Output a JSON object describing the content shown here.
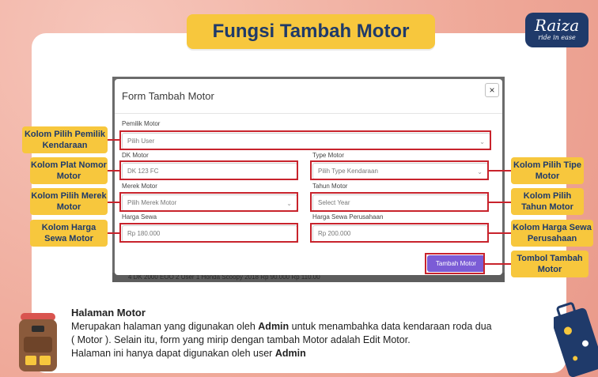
{
  "slide": {
    "title": "Fungsi Tambah Motor",
    "logo_brand": "Raiza",
    "logo_tagline": "ride in ease"
  },
  "modal": {
    "title": "Form Tambah Motor",
    "close_label": "×",
    "fields": {
      "owner": {
        "label": "Pemilik Motor",
        "placeholder": "Pilih User"
      },
      "plate": {
        "label": "DK Motor",
        "value": "DK 123 FC"
      },
      "type": {
        "label": "Type Motor",
        "placeholder": "Pilih Type Kendaraan"
      },
      "brand": {
        "label": "Merek Motor",
        "placeholder": "Pilih Merek Motor"
      },
      "year": {
        "label": "Tahun Motor",
        "placeholder": "Select Year"
      },
      "price": {
        "label": "Harga Sewa",
        "value": "Rp 180.000"
      },
      "company_price": {
        "label": "Harga Sewa Perusahaan",
        "value": "Rp 200.000"
      }
    },
    "submit_label": "Tambah Motor",
    "table_peek": "4     DK 2000 EOO 2     User 1               Honda          Scoopy          2018          Rp 90.000     Rp 110.00"
  },
  "callouts": {
    "owner": "Kolom Pilih Pemilik Kendaraan",
    "plate": "Kolom Plat Nomor Motor",
    "brand": "Kolom Pilih Merek Motor",
    "price": "Kolom Harga Sewa Motor",
    "type": "Kolom Pilih Tipe Motor",
    "year": "Kolom Pilih Tahun Motor",
    "company_price": "Kolom Harga Sewa Perusahaan",
    "submit": "Tombol Tambah Motor"
  },
  "description": {
    "heading": "Halaman Motor",
    "line1_pre": "Merupakan halaman yang digunakan oleh ",
    "line1_bold": "Admin",
    "line1_post": " untuk menambahka data kendaraan roda dua",
    "line2": "( Motor ). Selain itu, form yang mirip dengan tambah Motor adalah Edit Motor.",
    "line3_pre": "Halaman ini hanya dapat digunakan oleh user ",
    "line3_bold": "Admin"
  },
  "colors": {
    "accent_yellow": "#f7c73d",
    "highlight_red": "#c8232c",
    "button_purple": "#7b5cd6",
    "navy": "#1f3a6a"
  }
}
